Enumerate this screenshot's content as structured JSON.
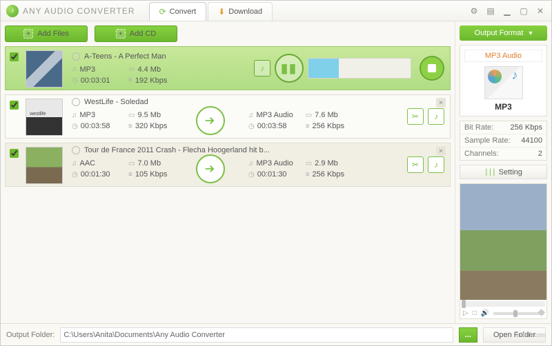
{
  "app_title": "ANY AUDIO CONVERTER",
  "tabs": {
    "convert": "Convert",
    "download": "Download"
  },
  "toolbar": {
    "add_files": "Add Files",
    "add_cd": "Add CD"
  },
  "items": [
    {
      "title": "A-Teens - A Perfect Man",
      "format": "MP3",
      "size": "4.4 Mb",
      "duration": "00:03:01",
      "bitrate": "192 Kbps",
      "state": "converting"
    },
    {
      "title": "WestLife - Soledad",
      "format": "MP3",
      "size": "9.5 Mb",
      "duration": "00:03:58",
      "bitrate": "320 Kbps",
      "out_format": "MP3 Audio",
      "out_size": "7.6 Mb",
      "out_duration": "00:03:58",
      "out_bitrate": "256 Kbps"
    },
    {
      "title": "Tour de France 2011 Crash - Flecha  Hoogerland hit b...",
      "format": "AAC",
      "size": "7.0 Mb",
      "duration": "00:01:30",
      "bitrate": "105 Kbps",
      "out_format": "MP3 Audio",
      "out_size": "2.9 Mb",
      "out_duration": "00:01:30",
      "out_bitrate": "256 Kbps"
    }
  ],
  "output": {
    "button": "Output Format",
    "format_title": "MP3 Audio",
    "format_label": "MP3",
    "props": {
      "bitrate_k": "Bit Rate:",
      "bitrate_v": "256 Kbps",
      "sample_k": "Sample Rate:",
      "sample_v": "44100",
      "channels_k": "Channels:",
      "channels_v": "2"
    },
    "setting": "Setting"
  },
  "footer": {
    "label": "Output Folder:",
    "path": "C:\\Users\\Anita\\Documents\\Any Audio Converter",
    "browse": "...",
    "open": "Open Folder"
  },
  "watermark": "LO4D.com"
}
